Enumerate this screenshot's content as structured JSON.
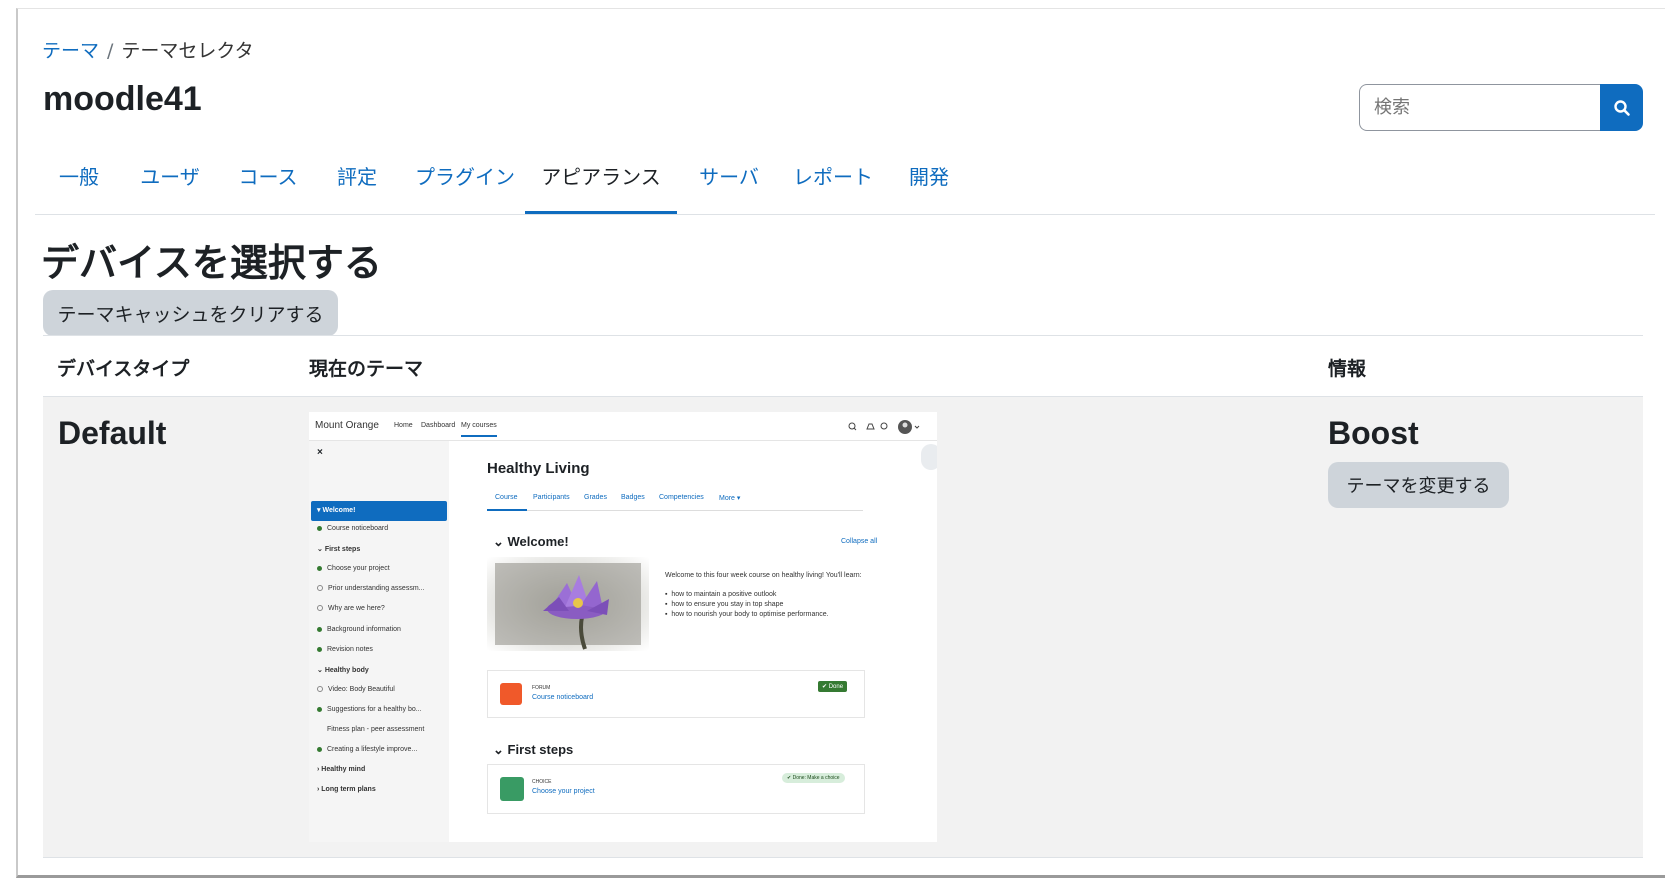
{
  "breadcrumb": {
    "items": [
      "テーマ",
      "テーマセレクタ"
    ],
    "separator": "/"
  },
  "page": {
    "title": "moodle41",
    "heading": "デバイスを選択する"
  },
  "search": {
    "placeholder": "検索",
    "button_icon": "search-icon"
  },
  "tabs": [
    {
      "label": "一般",
      "active": false
    },
    {
      "label": "ユーザ",
      "active": false
    },
    {
      "label": "コース",
      "active": false
    },
    {
      "label": "評定",
      "active": false
    },
    {
      "label": "プラグイン",
      "active": false
    },
    {
      "label": "アピアランス",
      "active": true
    },
    {
      "label": "サーバ",
      "active": false
    },
    {
      "label": "レポート",
      "active": false
    },
    {
      "label": "開発",
      "active": false
    }
  ],
  "actions": {
    "clear_cache": "テーマキャッシュをクリアする",
    "change_theme": "テーマを変更する"
  },
  "table": {
    "headers": {
      "device_type": "デバイスタイプ",
      "current_theme": "現在のテーマ",
      "info": "情報"
    },
    "rows": [
      {
        "device": "Default",
        "theme": "Boost"
      }
    ]
  },
  "preview": {
    "brand": "Mount Orange",
    "nav": [
      "Home",
      "Dashboard",
      "My courses"
    ],
    "close": "×",
    "sidebar": [
      {
        "label": "Welcome!",
        "type": "active"
      },
      {
        "label": "Course noticeboard",
        "type": "dot"
      },
      {
        "label": "First steps",
        "type": "section"
      },
      {
        "label": "Choose your project",
        "type": "dot"
      },
      {
        "label": "Prior understanding assessm...",
        "type": "odot"
      },
      {
        "label": "Why are we here?",
        "type": "odot"
      },
      {
        "label": "Background information",
        "type": "dot"
      },
      {
        "label": "Revision notes",
        "type": "dot"
      },
      {
        "label": "Healthy body",
        "type": "section"
      },
      {
        "label": "Video: Body Beautiful",
        "type": "odot"
      },
      {
        "label": "Suggestions for a healthy bo...",
        "type": "dot"
      },
      {
        "label": "Fitness plan - peer assessment",
        "type": "none"
      },
      {
        "label": "Creating a lifestyle improve...",
        "type": "dot"
      },
      {
        "label": "Healthy mind",
        "type": "collapsed"
      },
      {
        "label": "Long term plans",
        "type": "collapsed"
      }
    ],
    "course_title": "Healthy Living",
    "course_tabs": [
      "Course",
      "Participants",
      "Grades",
      "Badges",
      "Competencies",
      "More ▾"
    ],
    "welcome_heading": "Welcome!",
    "collapse_all": "Collapse all",
    "intro": "Welcome to this four week course on healthy living! You'll learn:",
    "bullets": [
      "how to maintain a positive outlook",
      "how to ensure you stay in top shape",
      "how to nourish your body to optimise performance."
    ],
    "forum_label": "FORUM",
    "forum_name": "Course noticeboard",
    "done_badge": "✔ Done",
    "first_steps_heading": "First steps",
    "choice_label": "CHOICE",
    "choice_name": "Choose your project",
    "choice_badge": "✔ Done: Make a choice"
  },
  "colors": {
    "accent": "#0f6cbf",
    "button_gray": "#ced4da",
    "row_bg": "#f2f2f2",
    "done_green": "#357a32"
  }
}
